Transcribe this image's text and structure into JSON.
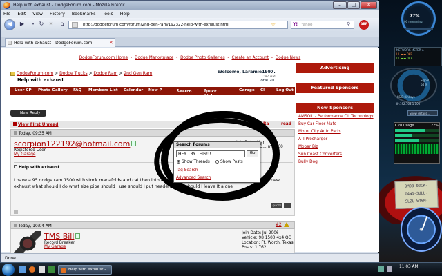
{
  "window": {
    "title": "Help with exhaust - DodgeForum.com - Mozilla Firefox"
  },
  "menu": [
    "File",
    "Edit",
    "View",
    "History",
    "Bookmarks",
    "Tools",
    "Help"
  ],
  "nav": {
    "url": "http://dodgeforum.com/forum/2nd-gen-ram/192322-help-with-exhaust.html",
    "search_placeholder": "Yahoo",
    "adblock": "ABP"
  },
  "tab": {
    "label": "Help with exhaust - DodgeForum.com"
  },
  "page": {
    "top_links": [
      "DodgeForum.com Home",
      "Dodge Marketplace",
      "Dodge Photo Galleries",
      "Create an Account",
      "Dodge News"
    ],
    "breadcrumb": [
      "DodgeForum.com",
      "Dodge Trucks",
      "Dodge Ram",
      "2nd Gen Ram"
    ],
    "thread_title": "Help with exhaust",
    "welcome": "Welcome, Laramie1997.",
    "welcome_time": "11:42 AM",
    "welcome_total": "Total 20.",
    "navbar": [
      "User CP",
      "Photo Gallery",
      "FAQ",
      "Members List",
      "Calendar",
      "New P",
      "Search",
      "Quick Links",
      "Garage",
      "Cl",
      "Log Out"
    ],
    "new_reply": "New Reply",
    "view_first_unread": "View First Unread",
    "rate_thread": "Ra",
    "thread_mode": "read"
  },
  "search_popup": {
    "header": "Search Forums",
    "input_value": "HEY TRY THIS!!!",
    "go": "Go",
    "opt_threads": "Show Threads",
    "opt_posts": "Show Posts",
    "tag_search": "Tag Search",
    "advanced": "Advanced Search"
  },
  "post1": {
    "date": "Today, 09:35 AM",
    "username": "scorpion122192@hotmail.com",
    "role": "Registered User",
    "garage": "My Garage",
    "join": "Join Date: Mar",
    "vehicle": "Vehicle: 95 D... m 1500",
    "title": "Help with exhaust",
    "body": "I have a 95 dodge ram 1500 with stock manafolds and cat then into one glass pack and into Dual pipes. when I go with new exhaust what should I do what size pipe should I use should I put headers on or should I leave It alone",
    "quote": "QUOTE"
  },
  "post2": {
    "date": "Today, 10:04 AM",
    "number": "#2",
    "username": "TMS Bill",
    "role": "Record Breaker",
    "garage": "My Garage",
    "join": "Join Date: Jul 2006",
    "vehicle": "Vehicle: 98 1500 4x4 QC",
    "location": "Location: Ft. Worth, Texas",
    "posts": "Posts: 1,762"
  },
  "sidebar": {
    "ads": "Advertising",
    "featured": "Featured Sponsors",
    "new_sponsors": "New Sponsors",
    "links": [
      "AMSOIL - Performance Oil Technology",
      "Buy Car Floor Mats",
      "Motor City Auto Parts",
      "ATI Procharger",
      "Mopar Biz",
      "Sun Coast Converters",
      "Bully Dog"
    ]
  },
  "status": "Done",
  "taskbar": {
    "task": "Help with exhaust -...",
    "clock": "11:03 AM"
  },
  "gadgets": {
    "net_percent": "77%",
    "net_rate": "00 remaining",
    "net_name": "NETWORK METER v.",
    "net_ip": "IP:192.168.1.100",
    "signal": "Signal",
    "signal_pct": "64 %",
    "ssid": "SSID: linksys",
    "show_details": "Show details...",
    "cpu_title": "CPU Usage",
    "cpu_pct": "22%",
    "note_lines": [
      "9MO8-02CK-",
      "O4W1-3ULL-",
      "SL2U-WT6M-"
    ]
  },
  "colors": {
    "brand_red": "#ad1a0b",
    "link_red": "#aa0000"
  }
}
